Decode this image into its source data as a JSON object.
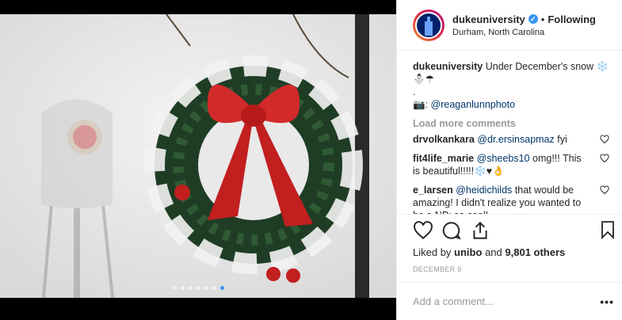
{
  "header": {
    "username": "dukeuniversity",
    "separator": "•",
    "follow_status": "Following",
    "location": "Durham, North Carolina"
  },
  "caption": {
    "author": "dukeuniversity",
    "text": "Under December's snow ❄️",
    "emoji_line": "⛄☂",
    "dot": ".",
    "camera": "📷:",
    "credit": "@reaganlunnphoto"
  },
  "load_more": "Load more comments",
  "comments": [
    {
      "user": "drvolkankara",
      "mention": "@dr.ersinsapmaz",
      "text": "fyi"
    },
    {
      "user": "fit4life_marie",
      "mention": "@sheebs10",
      "text": "omg!!! This is beautiful!!!!!❄️♥👌"
    },
    {
      "user": "e_larsen",
      "mention": "@heidichilds",
      "text": "that would be amazing! I didn't realize you wanted to be a NP: so cool!"
    }
  ],
  "likes": {
    "prefix": "Liked by",
    "user": "unibo",
    "joiner": "and",
    "count": "9,801 others"
  },
  "date": "DECEMBER 9",
  "add_comment_placeholder": "Add a comment...",
  "more_label": "•••",
  "carousel": {
    "total": 7,
    "active_index": 6
  },
  "colors": {
    "accent": "#3897f0",
    "wreath_bow": "#d22a2a",
    "mention": "#003569"
  },
  "icons": [
    "verified-icon",
    "heart-icon",
    "comment-icon",
    "share-icon",
    "bookmark-icon"
  ]
}
